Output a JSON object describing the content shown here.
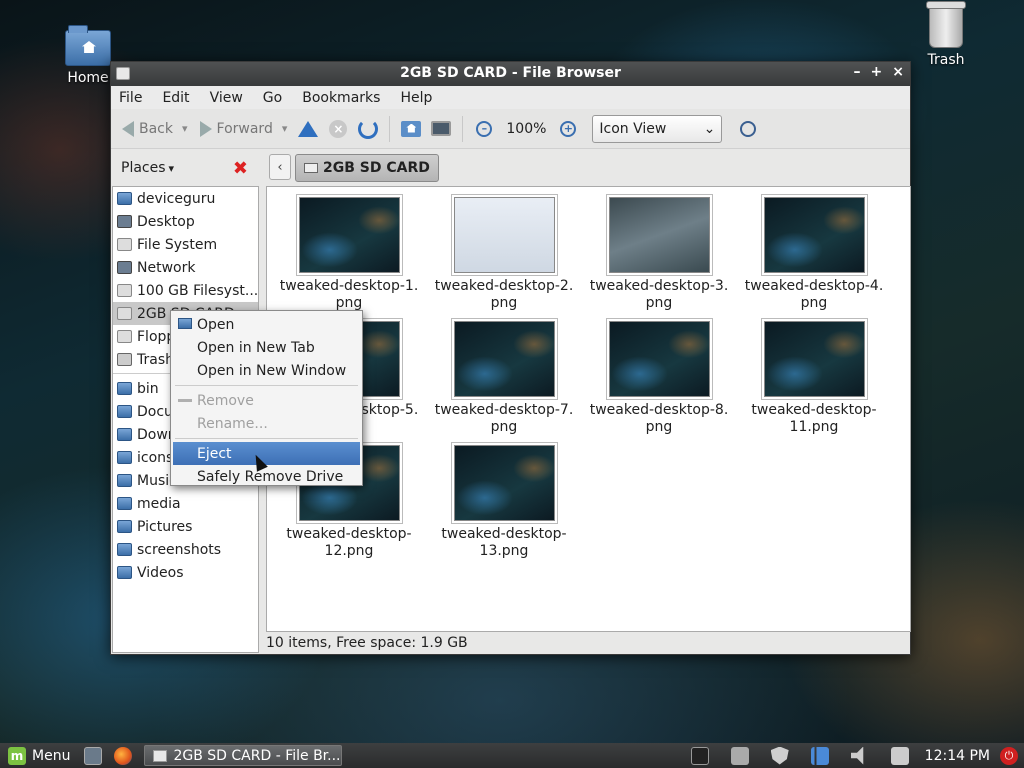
{
  "desktop": {
    "home_label": "Home",
    "trash_label": "Trash"
  },
  "window": {
    "title": "2GB SD CARD - File Browser",
    "controls": {
      "minimize": "–",
      "maximize": "+",
      "close": "×"
    }
  },
  "menubar": [
    "File",
    "Edit",
    "View",
    "Go",
    "Bookmarks",
    "Help"
  ],
  "toolbar": {
    "back_label": "Back",
    "forward_label": "Forward",
    "zoom_level": "100%",
    "view_mode": "Icon View"
  },
  "sidebar": {
    "header": "Places",
    "items": [
      {
        "label": "deviceguru",
        "icon": "home-folder-icon"
      },
      {
        "label": "Desktop",
        "icon": "desktop-icon"
      },
      {
        "label": "File System",
        "icon": "drive-icon"
      },
      {
        "label": "Network",
        "icon": "network-icon"
      },
      {
        "label": "100 GB Filesyst...",
        "icon": "drive-icon"
      },
      {
        "label": "2GB SD CARD",
        "icon": "drive-icon"
      },
      {
        "label": "Floppy",
        "icon": "floppy-icon"
      },
      {
        "label": "Trash",
        "icon": "trash-icon"
      }
    ],
    "bookmarks": [
      "bin",
      "Documents",
      "Downloads",
      "icons",
      "Music",
      "media",
      "Pictures",
      "screenshots",
      "Videos"
    ]
  },
  "pathbar": {
    "current": "2GB SD CARD"
  },
  "files": [
    {
      "line1": "tweaked-desktop-1.",
      "line2": "png"
    },
    {
      "line1": "tweaked-desktop-2.",
      "line2": "png"
    },
    {
      "line1": "tweaked-desktop-3.",
      "line2": "png"
    },
    {
      "line1": "tweaked-desktop-4.",
      "line2": "png"
    },
    {
      "line1": "tweaked-desktop-5.",
      "line2": "png"
    },
    {
      "line1": "tweaked-desktop-7.",
      "line2": "png"
    },
    {
      "line1": "tweaked-desktop-8.",
      "line2": "png"
    },
    {
      "line1": "tweaked-desktop-",
      "line2": "11.png"
    },
    {
      "line1": "tweaked-desktop-",
      "line2": "12.png"
    },
    {
      "line1": "tweaked-desktop-",
      "line2": "13.png"
    }
  ],
  "status": "10 items, Free space: 1.9 GB",
  "context_menu": {
    "items": [
      {
        "label": "Open",
        "state": "normal"
      },
      {
        "label": "Open in New Tab",
        "state": "normal"
      },
      {
        "label": "Open in New Window",
        "state": "normal"
      },
      {
        "label": "Remove",
        "state": "disabled"
      },
      {
        "label": "Rename...",
        "state": "disabled"
      },
      {
        "label": "Eject",
        "state": "highlighted"
      },
      {
        "label": "Safely Remove Drive",
        "state": "normal"
      }
    ]
  },
  "taskbar": {
    "menu_label": "Menu",
    "task_label": "2GB SD CARD - File Br...",
    "clock": "12:14 PM"
  },
  "colors": {
    "highlight": "#3d6fb5",
    "folder_blue": "#3c6fa8",
    "taskbar": "#2a2b2c"
  }
}
